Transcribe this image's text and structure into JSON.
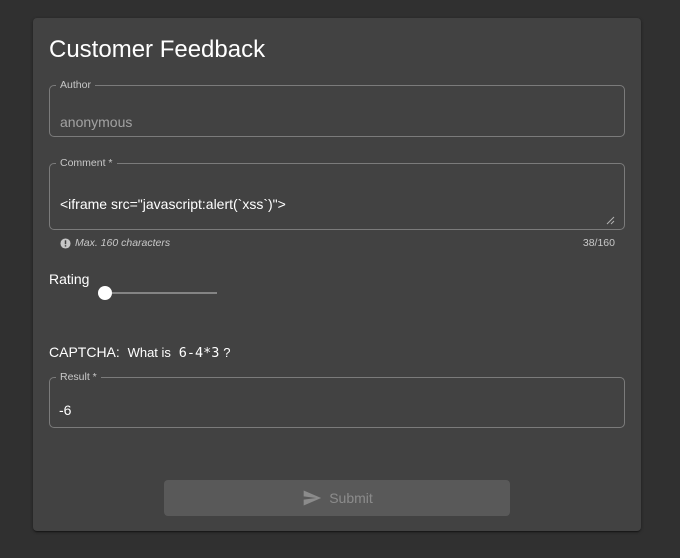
{
  "form": {
    "title": "Customer Feedback",
    "author": {
      "label": "Author",
      "value": "anonymous"
    },
    "comment": {
      "label": "Comment *",
      "value": "<iframe src=\"javascript:alert(`xss`)\">",
      "hint": "Max. 160 characters",
      "counter": "38/160"
    },
    "rating": {
      "label": "Rating",
      "value": 1,
      "min": 1,
      "max": 5
    },
    "captcha": {
      "label": "CAPTCHA:",
      "question_prefix": "What is",
      "expression": "6-4*3",
      "question_suffix": "?"
    },
    "result": {
      "label": "Result *",
      "value": "-6"
    },
    "submit": {
      "label": "Submit",
      "icon": "send-icon"
    }
  },
  "colors": {
    "background": "#303030",
    "card": "#424242",
    "valid_accent": "#69a23a"
  }
}
